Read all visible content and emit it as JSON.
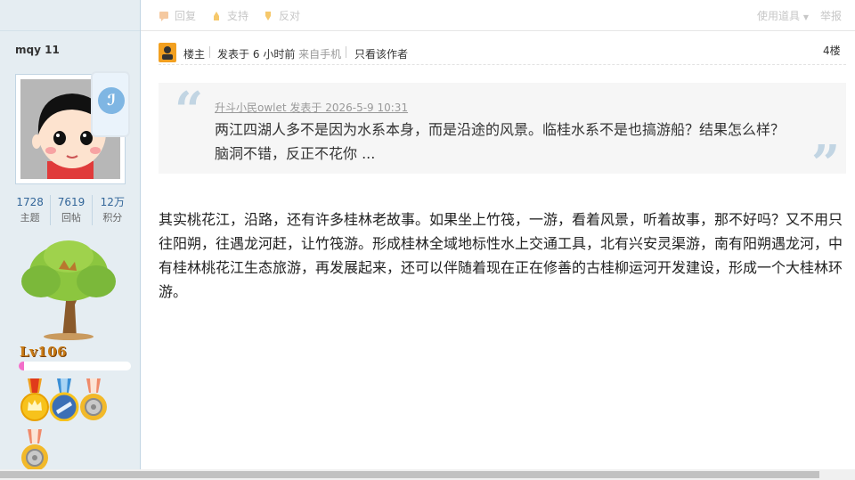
{
  "toolbar": {
    "reply": "回复",
    "support": "支持",
    "oppose": "反对",
    "use_item": "使用道具",
    "report": "举报"
  },
  "user": {
    "name": "mqy 11",
    "stats": [
      {
        "value": "1728",
        "label": "主题"
      },
      {
        "value": "7619",
        "label": "回帖"
      },
      {
        "value": "12万",
        "label": "积分"
      }
    ],
    "level": "Lv106",
    "level_progress": 0.05,
    "phone_glyph": "ℐ"
  },
  "post": {
    "role": "楼主",
    "posted": "发表于",
    "posted_count": "6",
    "posted_unit": "小时前",
    "from_mobile": "来自手机",
    "only_author": "只看该作者",
    "floor": "4楼",
    "quote": {
      "meta": "升斗小民owlet 发表于 2026-5-9 10:31",
      "text": "两江四湖人多不是因为水系本身，而是沿途的风景。临桂水系不是也搞游船？结果怎么样？脑洞不错，反正不花你 ..."
    },
    "body": "其实桃花江，沿路，还有许多桂林老故事。如果坐上竹筏，一游，看着风景，听着故事，那不好吗？又不用只往阳朔，往遇龙河赶，让竹筏游。形成桂林全域地标性水上交通工具，北有兴安灵渠游，南有阳朔遇龙河，中有桂林桃花江生态旅游，再发展起来，还可以伴随着现在正在修善的古桂柳运河开发建设，形成一个大桂林环游。"
  },
  "colors": {
    "sidebar_bg": "#e5edf2",
    "link": "#336699",
    "level": "#c97a13",
    "progress": "#f36ec9"
  }
}
